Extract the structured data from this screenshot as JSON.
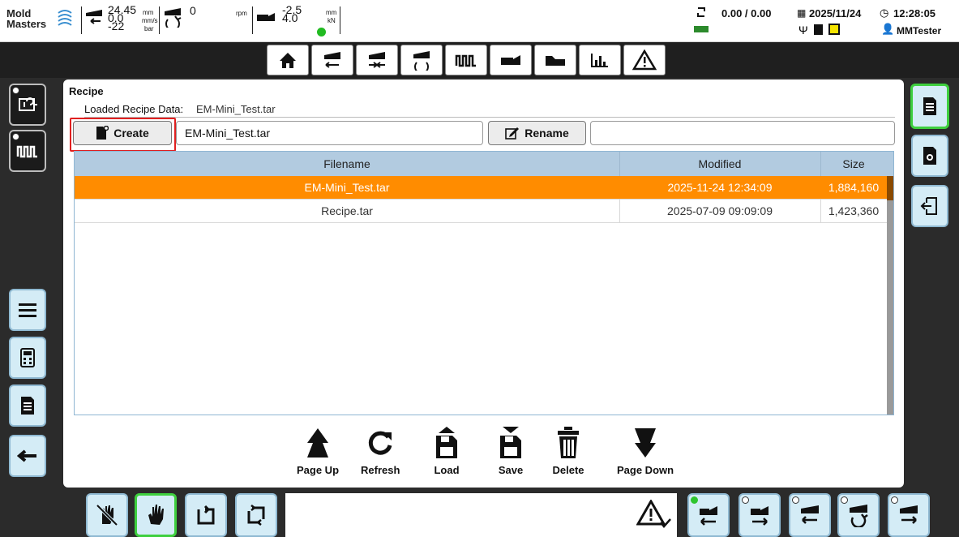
{
  "statusbar": {
    "logo_top": "Mold",
    "logo_bottom": "Masters",
    "pos_top": "24.45",
    "pos_mid": "0.0",
    "pos_bot": "-22",
    "unit_mm": "mm",
    "unit_mms": "mm/s",
    "unit_bar": "bar",
    "screw_val": "0",
    "unit_rpm": "rpm",
    "carriage_top": "-2.5",
    "carriage_bot": "4.0",
    "unit_mm2": "mm",
    "unit_kn": "kN",
    "cycle": "0.00 / 0.00",
    "date": "2025/11/24",
    "time": "12:28:05",
    "user": "MMTester"
  },
  "panel": {
    "title": "Recipe",
    "loaded_label": "Loaded Recipe Data:",
    "loaded_value": "EM-Mini_Test.tar",
    "create_label": "Create",
    "filename_value": "EM-Mini_Test.tar",
    "rename_label": "Rename",
    "rename_value": ""
  },
  "table": {
    "headers": [
      "Filename",
      "Modified",
      "Size"
    ],
    "rows": [
      {
        "filename": "EM-Mini_Test.tar",
        "modified": "2025-11-24 12:34:09",
        "size": "1,884,160",
        "selected": true
      },
      {
        "filename": "Recipe.tar",
        "modified": "2025-07-09 09:09:09",
        "size": "1,423,360",
        "selected": false
      }
    ]
  },
  "actions": {
    "page_up": "Page Up",
    "refresh": "Refresh",
    "load": "Load",
    "save": "Save",
    "delete": "Delete",
    "page_down": "Page Down"
  },
  "colors": {
    "accent": "#ff8c00",
    "highlight": "#e02020",
    "active_border": "#3ecf3e",
    "table_header": "#b2cbe0"
  },
  "icons": {
    "toolbar": [
      "home-icon",
      "injection-icon",
      "hold-icon",
      "screw-icon",
      "heater-icon",
      "carriage-icon",
      "profile-icon",
      "chart-icon",
      "warning-icon"
    ],
    "left_top": [
      "motor-icon",
      "heater-icon"
    ],
    "left_bottom": [
      "menu-icon",
      "calculator-icon",
      "document-icon",
      "back-arrow-icon"
    ],
    "right": [
      "recipe-icon",
      "recipe-settings-icon",
      "export-icon"
    ],
    "bottom_left": [
      "hand-off-icon",
      "hand-manual-icon",
      "semi-auto-icon",
      "auto-cycle-icon"
    ],
    "bottom_right": [
      "carriage-back-icon",
      "carriage-forward-icon",
      "injection-back-icon",
      "screw-rotate-icon",
      "injection-forward-icon"
    ]
  }
}
